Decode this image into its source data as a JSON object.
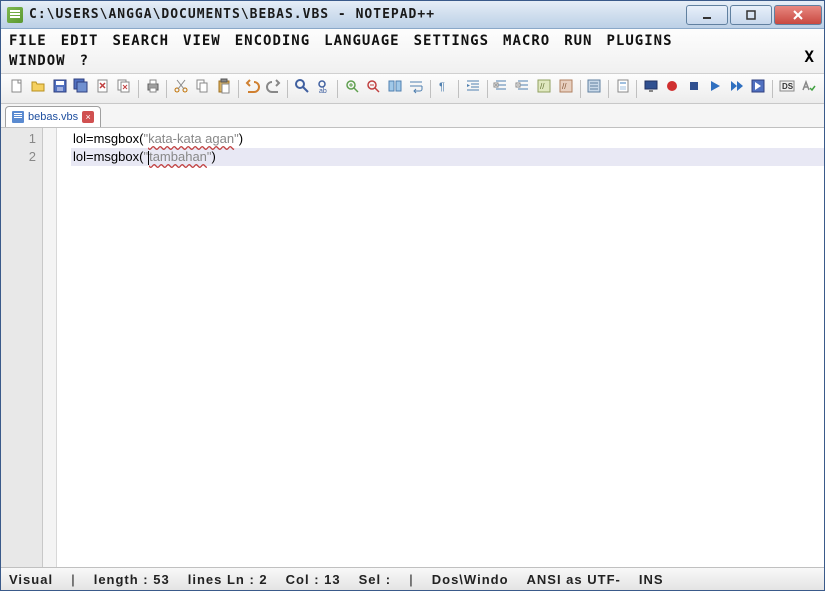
{
  "window": {
    "title": "C:\\USERS\\ANGGA\\DOCUMENTS\\BEBAS.VBS - NOTEPAD++"
  },
  "menu": {
    "items": [
      "FILE",
      "EDIT",
      "SEARCH",
      "VIEW",
      "ENCODING",
      "LANGUAGE",
      "SETTINGS",
      "MACRO",
      "RUN",
      "PLUGINS"
    ],
    "items2": [
      "WINDOW",
      "?"
    ],
    "close_x": "X"
  },
  "toolbar": {
    "icons": [
      "new",
      "open",
      "save",
      "save-all",
      "close",
      "close-all",
      "print",
      "cut",
      "copy",
      "paste",
      "undo",
      "redo",
      "find",
      "replace",
      "zoom-in",
      "zoom-out",
      "sync",
      "wrap",
      "all-chars",
      "indent",
      "fold",
      "unfold",
      "comment",
      "uncomment",
      "func-list",
      "doc-map",
      "monitor",
      "record",
      "stop",
      "play",
      "play-multi",
      "save-macro",
      "ds",
      "spell"
    ]
  },
  "tab": {
    "label": "bebas.vbs",
    "close": "×"
  },
  "code": {
    "lines": [
      {
        "n": "1",
        "pre": "lol=msgbox(",
        "q1": "\"",
        "wavy": "kata-kata agan",
        "q2": "\"",
        "post": ")"
      },
      {
        "n": "2",
        "pre": "lol=msgbox(",
        "q1": "\"",
        "cursor": true,
        "wavy": "tambahan",
        "q2": "\"",
        "post": ")"
      }
    ]
  },
  "status": {
    "visual": "Visual",
    "length_label": "length :",
    "length": "53",
    "lines_label": "lines Ln :",
    "lines": "2",
    "col_label": "Col :",
    "col": "13",
    "sel_label": "Sel :",
    "os": "Dos\\Windo",
    "enc": "ANSI as UTF-",
    "ins": "INS"
  }
}
